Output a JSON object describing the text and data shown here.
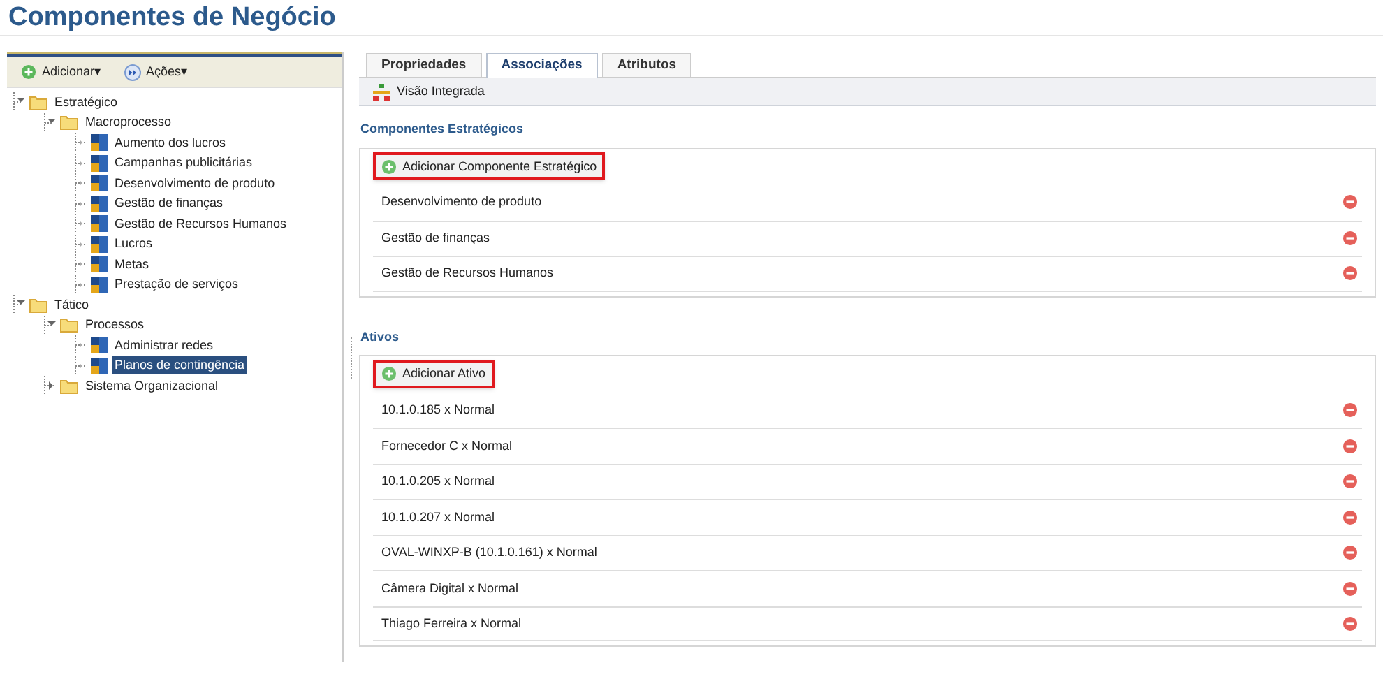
{
  "page_title": "Componentes de Negócio",
  "toolbar": [
    {
      "label": "Adicionar▾",
      "kind": "add"
    },
    {
      "label": "Ações▾",
      "kind": "actions"
    }
  ],
  "tree": [
    {
      "label": "Estratégico",
      "kind": "folder",
      "expanded": true,
      "selected": false,
      "children": [
        {
          "label": "Macroprocesso",
          "kind": "folder",
          "expanded": true,
          "selected": false,
          "children": [
            {
              "label": "Aumento dos lucros",
              "kind": "item",
              "selected": false
            },
            {
              "label": "Campanhas publicitárias",
              "kind": "item",
              "selected": false
            },
            {
              "label": "Desenvolvimento de produto",
              "kind": "item",
              "selected": false
            },
            {
              "label": "Gestão de finanças",
              "kind": "item",
              "selected": false
            },
            {
              "label": "Gestão de Recursos Humanos",
              "kind": "item",
              "selected": false
            },
            {
              "label": "Lucros",
              "kind": "item",
              "selected": false
            },
            {
              "label": "Metas",
              "kind": "item",
              "selected": false
            },
            {
              "label": "Prestação de serviços",
              "kind": "item",
              "selected": false
            }
          ]
        }
      ]
    },
    {
      "label": "Tático",
      "kind": "folder",
      "expanded": true,
      "selected": false,
      "children": [
        {
          "label": "Processos",
          "kind": "folder",
          "expanded": true,
          "selected": false,
          "children": [
            {
              "label": "Administrar redes",
              "kind": "item",
              "selected": false
            },
            {
              "label": "Planos de contingência",
              "kind": "item",
              "selected": true
            }
          ]
        },
        {
          "label": "Sistema Organizacional",
          "kind": "folder",
          "expanded": false,
          "selected": false
        }
      ]
    }
  ],
  "tabs": [
    {
      "label": "Propriedades",
      "selected": false
    },
    {
      "label": "Associações",
      "selected": true
    },
    {
      "label": "Atributos",
      "selected": false
    }
  ],
  "view_button": "Visão Integrada",
  "sections": [
    {
      "title": "Componentes Estratégicos",
      "add_button": "Adicionar Componente Estratégico",
      "highlighted": true,
      "items": [
        "Desenvolvimento de produto",
        "Gestão de finanças",
        "Gestão de Recursos Humanos"
      ]
    },
    {
      "title": "Ativos",
      "add_button": "Adicionar Ativo",
      "highlighted": true,
      "items": [
        "10.1.0.185 x Normal",
        "Fornecedor C x Normal",
        "10.1.0.205 x Normal",
        "10.1.0.207 x Normal",
        "OVAL-WINXP-B (10.1.0.161) x Normal",
        "Câmera Digital x Normal",
        "Thiago Ferreira x Normal"
      ]
    }
  ]
}
